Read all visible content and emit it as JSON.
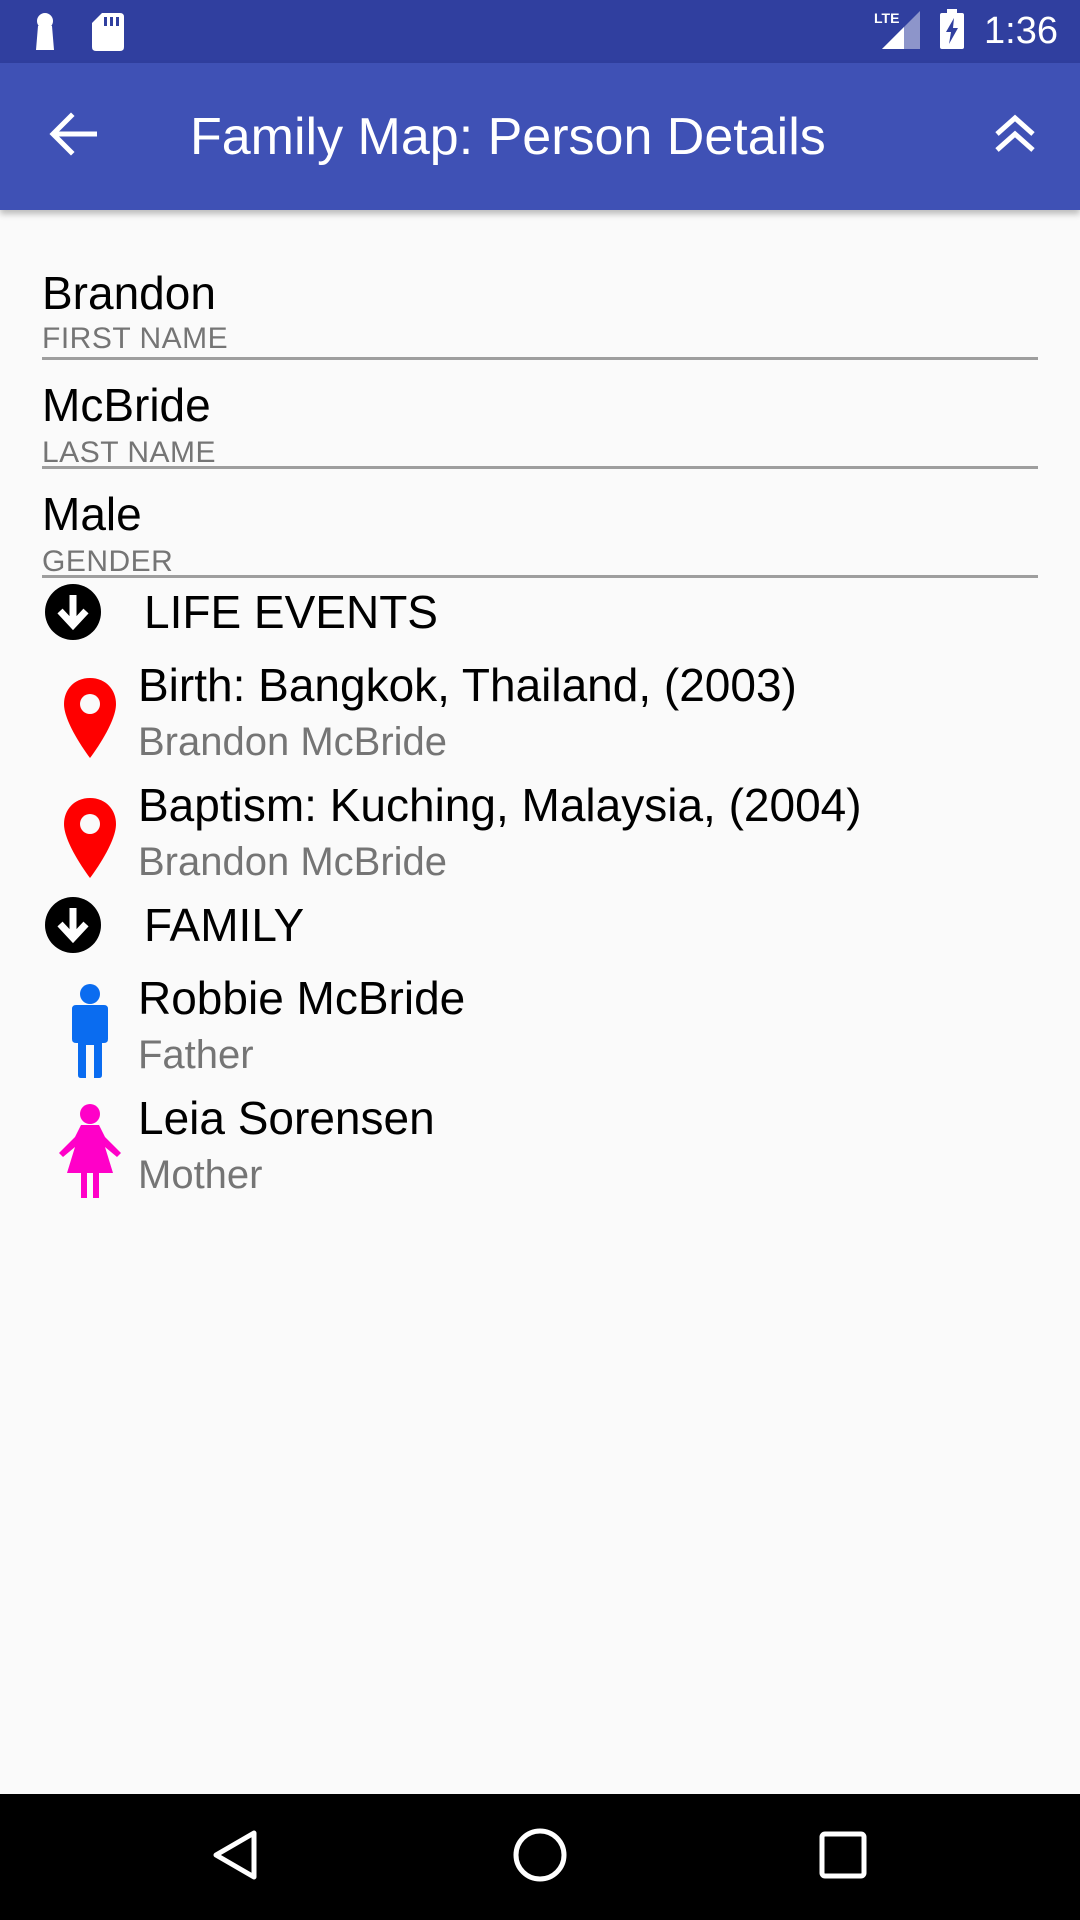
{
  "status_bar": {
    "time": "1:36",
    "network": "LTE",
    "icons": [
      "notification-icon",
      "sd-card-icon",
      "signal-icon",
      "battery-charging-icon"
    ]
  },
  "app_bar": {
    "title": "Family Map: Person Details",
    "back_icon": "arrow-back-icon",
    "top_icon": "double-chevron-up-icon"
  },
  "person": {
    "first_name": {
      "value": "Brandon",
      "label": "FIRST NAME"
    },
    "last_name": {
      "value": "McBride",
      "label": "LAST NAME"
    },
    "gender": {
      "value": "Male",
      "label": "GENDER"
    }
  },
  "life_events": {
    "header": "LIFE EVENTS",
    "items": [
      {
        "title": "Birth: Bangkok, Thailand, (2003)",
        "person": "Brandon McBride",
        "icon": "map-marker-icon"
      },
      {
        "title": "Baptism: Kuching, Malaysia, (2004)",
        "person": "Brandon McBride",
        "icon": "map-marker-icon"
      }
    ]
  },
  "family": {
    "header": "FAMILY",
    "items": [
      {
        "name": "Robbie McBride",
        "relation": "Father",
        "icon": "male-icon"
      },
      {
        "name": "Leia Sorensen",
        "relation": "Mother",
        "icon": "female-icon"
      }
    ]
  },
  "colors": {
    "status_bar": "#303f9f",
    "app_bar": "#3f51b5",
    "event_marker": "#ff0000",
    "male": "#0a6cf0",
    "female": "#ff00c8"
  },
  "nav_bar": {
    "buttons": [
      "back-triangle-icon",
      "home-circle-icon",
      "recents-square-icon"
    ]
  }
}
